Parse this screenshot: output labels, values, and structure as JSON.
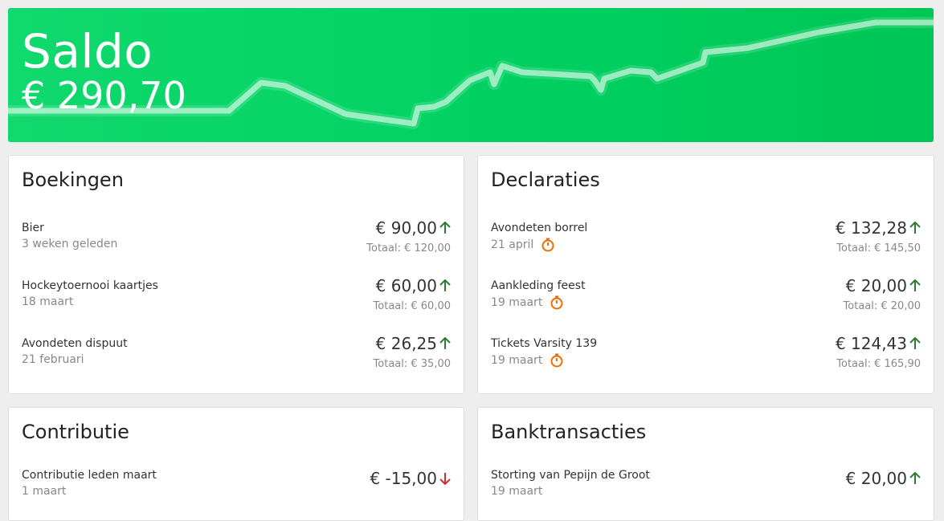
{
  "saldo": {
    "title": "Saldo",
    "amount": "€ 290,70"
  },
  "boekingen": {
    "title": "Boekingen",
    "items": [
      {
        "name": "Bier",
        "sub": "3 weken geleden",
        "amount": "€ 90,00",
        "total": "Totaal: € 120,00",
        "direction": "up"
      },
      {
        "name": "Hockeytoernooi kaartjes",
        "sub": "18 maart",
        "amount": "€ 60,00",
        "total": "Totaal: € 60,00",
        "direction": "up"
      },
      {
        "name": "Avondeten dispuut",
        "sub": "21 februari",
        "amount": "€ 26,25",
        "total": "Totaal: € 35,00",
        "direction": "up"
      }
    ]
  },
  "declaraties": {
    "title": "Declaraties",
    "items": [
      {
        "name": "Avondeten borrel",
        "sub": "21 april",
        "amount": "€ 132,28",
        "total": "Totaal: € 145,50",
        "direction": "up",
        "status_icon": "timer-icon"
      },
      {
        "name": "Aankleding feest",
        "sub": "19 maart",
        "amount": "€ 20,00",
        "total": "Totaal: € 20,00",
        "direction": "up",
        "status_icon": "timer-icon"
      },
      {
        "name": "Tickets Varsity 139",
        "sub": "19 maart",
        "amount": "€ 124,43",
        "total": "Totaal: € 165,90",
        "direction": "up",
        "status_icon": "timer-icon"
      }
    ]
  },
  "contributie": {
    "title": "Contributie",
    "items": [
      {
        "name": "Contributie leden maart",
        "sub": "1 maart",
        "amount": "€ -15,00",
        "direction": "down"
      }
    ]
  },
  "banktransacties": {
    "title": "Banktransacties",
    "items": [
      {
        "name": "Storting van Pepijn de Groot",
        "sub": "19 maart",
        "amount": "€ 20,00",
        "direction": "up"
      }
    ]
  },
  "colors": {
    "saldo_green": "#00cf60",
    "up_arrow": "#2e7d32",
    "down_arrow": "#d32f2f",
    "timer": "#ef6c00"
  }
}
